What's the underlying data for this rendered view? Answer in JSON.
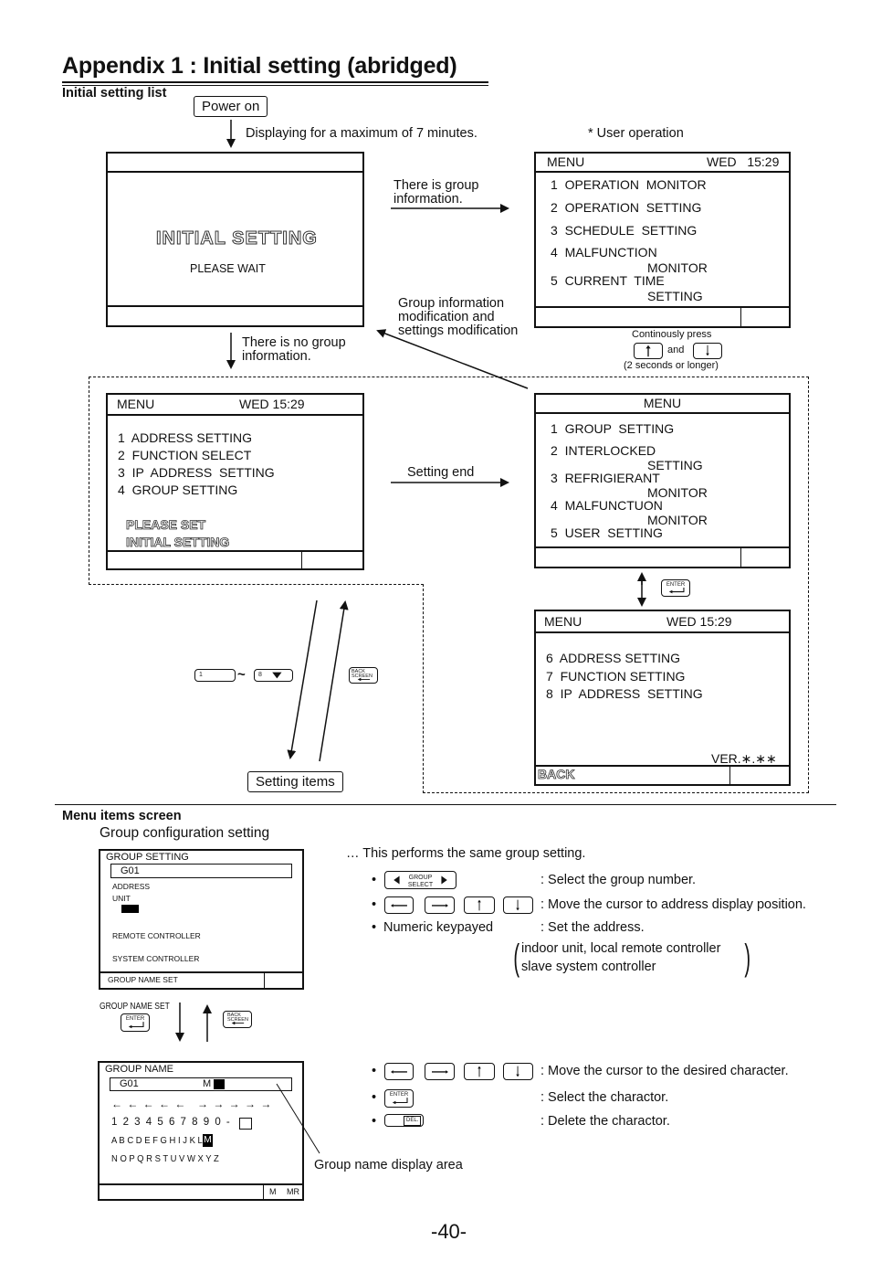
{
  "header": {
    "title": "Appendix 1 : Initial setting (abridged)",
    "section": "Initial setting list",
    "user_operation_note": "* User operation"
  },
  "flow": {
    "power_on": "Power on",
    "display_note": "Displaying for a maximum of 7 minutes.",
    "group_info_yes": "There is group information.",
    "group_info_no": "There is no group information.",
    "modification_note": "Group information modification and settings modification",
    "setting_end": "Setting end",
    "setting_items": "Setting items",
    "continuous_press": {
      "line1": "Continously press",
      "and": "and",
      "line3": "(2 seconds or longer)"
    },
    "range_tilde": "~",
    "key_1_label": "1",
    "key_8_label": "8"
  },
  "screens": {
    "initial": {
      "title": "INITIAL  SETTING",
      "subtitle": "PLEASE  WAIT"
    },
    "user_menu": {
      "header_left": "MENU",
      "header_right": "WED   15:29",
      "items": [
        "1  OPERATION  MONITOR",
        "2  OPERATION  SETTING",
        "3  SCHEDULE  SETTING",
        "4  MALFUNCTION",
        "MONITOR",
        "5  CURRENT  TIME",
        "SETTING"
      ]
    },
    "installer_menu": {
      "header_left": "MENU",
      "header_right": "WED 15:29",
      "items": [
        "1  ADDRESS SETTING",
        "2  FUNCTION SELECT",
        "3  IP  ADDRESS  SETTING",
        "4  GROUP SETTING"
      ],
      "notice_line1": "PLEASE SET",
      "notice_line2": "INITIAL SETTING"
    },
    "service_menu_1": {
      "header": "MENU",
      "items": [
        "1  GROUP  SETTING",
        "2  INTERLOCKED",
        "SETTING",
        "3  REFRIGIERANT",
        "MONITOR",
        "4  MALFUNCTUON",
        "MONITOR",
        "5  USER  SETTING"
      ]
    },
    "service_menu_2": {
      "header_left": "MENU",
      "header_right": "WED 15:29",
      "items": [
        "6  ADDRESS SETTING",
        "7  FUNCTION SETTING",
        "8  IP  ADDRESS  SETTING"
      ],
      "version": "VER.∗.∗∗",
      "footer_left": "BACK"
    }
  },
  "keys": {
    "enter": "ENTER",
    "back_screen_1": "BACK",
    "back_screen_2": "SCREEN",
    "group_select_1": "GROUP",
    "group_select_2": "SELECT",
    "del": "DEL."
  },
  "menu_items_section": {
    "heading": "Menu items screen",
    "subheading": "Group configuration setting",
    "same_setting_note": "… This performs the same group setting.",
    "group_setting_screen": {
      "title": "GROUP  SETTING",
      "group_field": "G01",
      "labels": [
        "ADDRESS",
        "UNIT",
        "REMOTE  CONTROLLER",
        "SYSTEM  CONTROLLER"
      ],
      "footer_left": "GROUP  NAME  SET"
    },
    "instructions_1": [
      {
        "bullet": "•",
        "keys": "group-select",
        "desc": ": Select the group number."
      },
      {
        "bullet": "•",
        "keys": "arrows",
        "desc": ": Move the cursor to address display position."
      },
      {
        "bullet": "•",
        "keys": "Numeric keypayed",
        "desc": ": Set the address."
      }
    ],
    "address_targets_line1": "indoor unit, local remote controller",
    "address_targets_line2": "slave system controller",
    "group_name_set_label": "GROUP  NAME  SET",
    "group_name_screen": {
      "title": "GROUP  NAME",
      "group_field": "G01",
      "name_value": "M",
      "arrows_left": "← ← ← ← ←",
      "arrows_right": "→ → → → →",
      "row_digits": "1 2 3 4 5 6 7 8 9 0 -",
      "row_letters_1": "A B C D E F G H I  J K L",
      "row_letters_1_selected": "M",
      "row_letters_2": "N O P Q R S T U V W X Y Z",
      "footer_right_1": "M",
      "footer_right_2": "MR"
    },
    "instructions_2": [
      {
        "bullet": "•",
        "desc": ": Move the cursor to the desired character."
      },
      {
        "bullet": "•",
        "desc": ": Select the charactor."
      },
      {
        "bullet": "•",
        "desc": ": Delete the charactor."
      }
    ],
    "display_area_label": "Group name display area"
  },
  "page_number": "-40-"
}
